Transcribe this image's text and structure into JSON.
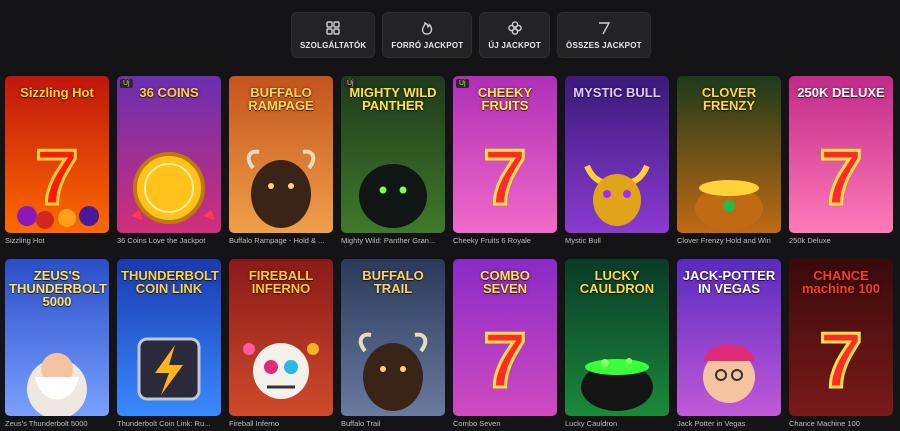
{
  "filters": [
    {
      "label": "SZOLGÁLTATÓK",
      "icon": "grid-icon"
    },
    {
      "label": "FORRÓ JACKPOT",
      "icon": "flame-icon"
    },
    {
      "label": "ÚJ JACKPOT",
      "icon": "clover-icon"
    },
    {
      "label": "ÖSSZES JACKPOT",
      "icon": "seven-icon"
    }
  ],
  "games": [
    {
      "name": "Sizzling Hot",
      "logo": "Sizzling Hot",
      "badge": "",
      "bg": "#c0160d",
      "bg2": "#ff6a00",
      "logo_color": "#ffd23a",
      "art": "seven-fruits"
    },
    {
      "name": "36 Coins Love the Jackpot",
      "logo": "36 COINS",
      "badge": "Új",
      "bg": "#6a2fb0",
      "bg2": "#d12f7a",
      "logo_color": "#ffcf3a",
      "art": "coin"
    },
    {
      "name": "Buffalo Rampage - Hold & ...",
      "logo": "BUFFALO RAMPAGE",
      "badge": "",
      "bg": "#c4541c",
      "bg2": "#f0a04a",
      "logo_color": "#ffd35a",
      "art": "buffalo"
    },
    {
      "name": "Mighty Wild: Panther Gran...",
      "logo": "MIGHTY WILD PANTHER",
      "badge": "Új",
      "bg": "#1f3a1c",
      "bg2": "#3f7a2a",
      "logo_color": "#ffe24a",
      "art": "panther"
    },
    {
      "name": "Cheeky Fruits 6 Royale",
      "logo": "CHEEKY FRUITS",
      "badge": "Új",
      "bg": "#b02fb8",
      "bg2": "#f06ac8",
      "logo_color": "#ffe84a",
      "art": "seven"
    },
    {
      "name": "Mystic Bull",
      "logo": "MYSTIC BULL",
      "badge": "",
      "bg": "#3a1a7a",
      "bg2": "#8a3ad0",
      "logo_color": "#e0c8ff",
      "art": "bull"
    },
    {
      "name": "Clover Frenzy Hold and Win",
      "logo": "CLOVER FRENZY",
      "badge": "",
      "bg": "#1d3a1a",
      "bg2": "#c06a14",
      "logo_color": "#ffd84a",
      "art": "pot"
    },
    {
      "name": "250k Deluxe",
      "logo": "250K DELUXE",
      "badge": "",
      "bg": "#c22a8a",
      "bg2": "#ff7ab8",
      "logo_color": "#ffffff",
      "art": "seven"
    },
    {
      "name": "Zeus's Thunderbolt 5000",
      "logo": "ZEUS'S THUNDERBOLT 5000",
      "badge": "",
      "bg": "#2a4ec8",
      "bg2": "#7aa0ff",
      "logo_color": "#ffe15a",
      "art": "zeus"
    },
    {
      "name": "Thunderbolt Coin Link: Ru...",
      "logo": "THUNDERBOLT COIN LINK",
      "badge": "",
      "bg": "#1a3ab0",
      "bg2": "#3a8aff",
      "logo_color": "#ffd23a",
      "art": "bolt"
    },
    {
      "name": "Fireball Inferno",
      "logo": "FIREBALL INFERNO",
      "badge": "",
      "bg": "#8a1a1a",
      "bg2": "#d04a2a",
      "logo_color": "#ffc83a",
      "art": "skull"
    },
    {
      "name": "Buffalo Trail",
      "logo": "BUFFALO TRAIL",
      "badge": "",
      "bg": "#2a3a5a",
      "bg2": "#6a7aa0",
      "logo_color": "#ffd06a",
      "art": "buffalo"
    },
    {
      "name": "Combo Seven",
      "logo": "COMBO SEVEN",
      "badge": "",
      "bg": "#8a2ac8",
      "bg2": "#d04ac0",
      "logo_color": "#ffe04a",
      "art": "seven"
    },
    {
      "name": "Lucky Cauldron",
      "logo": "LUCKY CAULDRON",
      "badge": "",
      "bg": "#0a3a2a",
      "bg2": "#1a8a3a",
      "logo_color": "#ffd84a",
      "art": "cauldron"
    },
    {
      "name": "Jack Potter in Vegas",
      "logo": "JACK-POTTER IN VEGAS",
      "badge": "",
      "bg": "#5a2ac0",
      "bg2": "#c05ad8",
      "logo_color": "#ffffff",
      "art": "jester"
    },
    {
      "name": "Chance Machine 100",
      "logo": "CHANCE machine 100",
      "badge": "",
      "bg": "#3a0a0a",
      "bg2": "#7a1a1a",
      "logo_color": "#ff3a2a",
      "art": "seven"
    }
  ]
}
